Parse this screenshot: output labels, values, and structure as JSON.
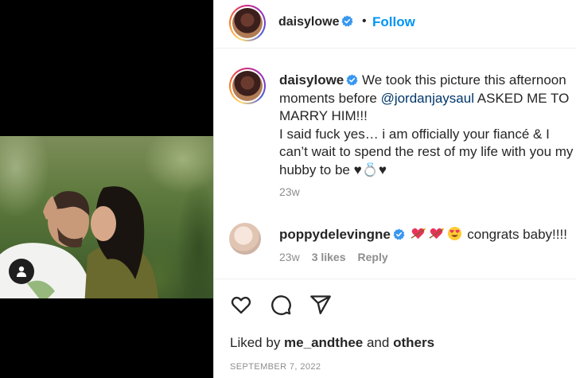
{
  "post_author": {
    "username": "daisylowe",
    "follow_label": "Follow",
    "separator": "•"
  },
  "caption": {
    "username": "daisylowe",
    "text_part1": "We took this picture this afternoon moments before ",
    "mention": "@jordanjaysaul",
    "text_part2": " ASKED ME TO MARRY HIM!!!",
    "line2": "I said fuck yes… i am officially your fiancé & I can’t wait to spend the rest of my life with you my hubby to be ♥💍♥",
    "time": "23w"
  },
  "comment": {
    "username": "poppydelevingne",
    "text": " congrats baby!!!!",
    "time": "23w",
    "likes": "3 likes",
    "reply": "Reply"
  },
  "liked_by": {
    "prefix": "Liked by ",
    "user": "me_andthee",
    "middle": " and ",
    "others": "others"
  },
  "date": "SEPTEMBER 7, 2022",
  "icons": {
    "verified": "verified-badge-icon",
    "like": "heart-icon",
    "comment": "comment-icon",
    "share": "share-icon",
    "tagged_user": "user-tag-icon"
  },
  "colors": {
    "accent": "#0095f6",
    "verified": "#3897f0",
    "mention": "#00376b",
    "muted": "#8e8e8e"
  }
}
